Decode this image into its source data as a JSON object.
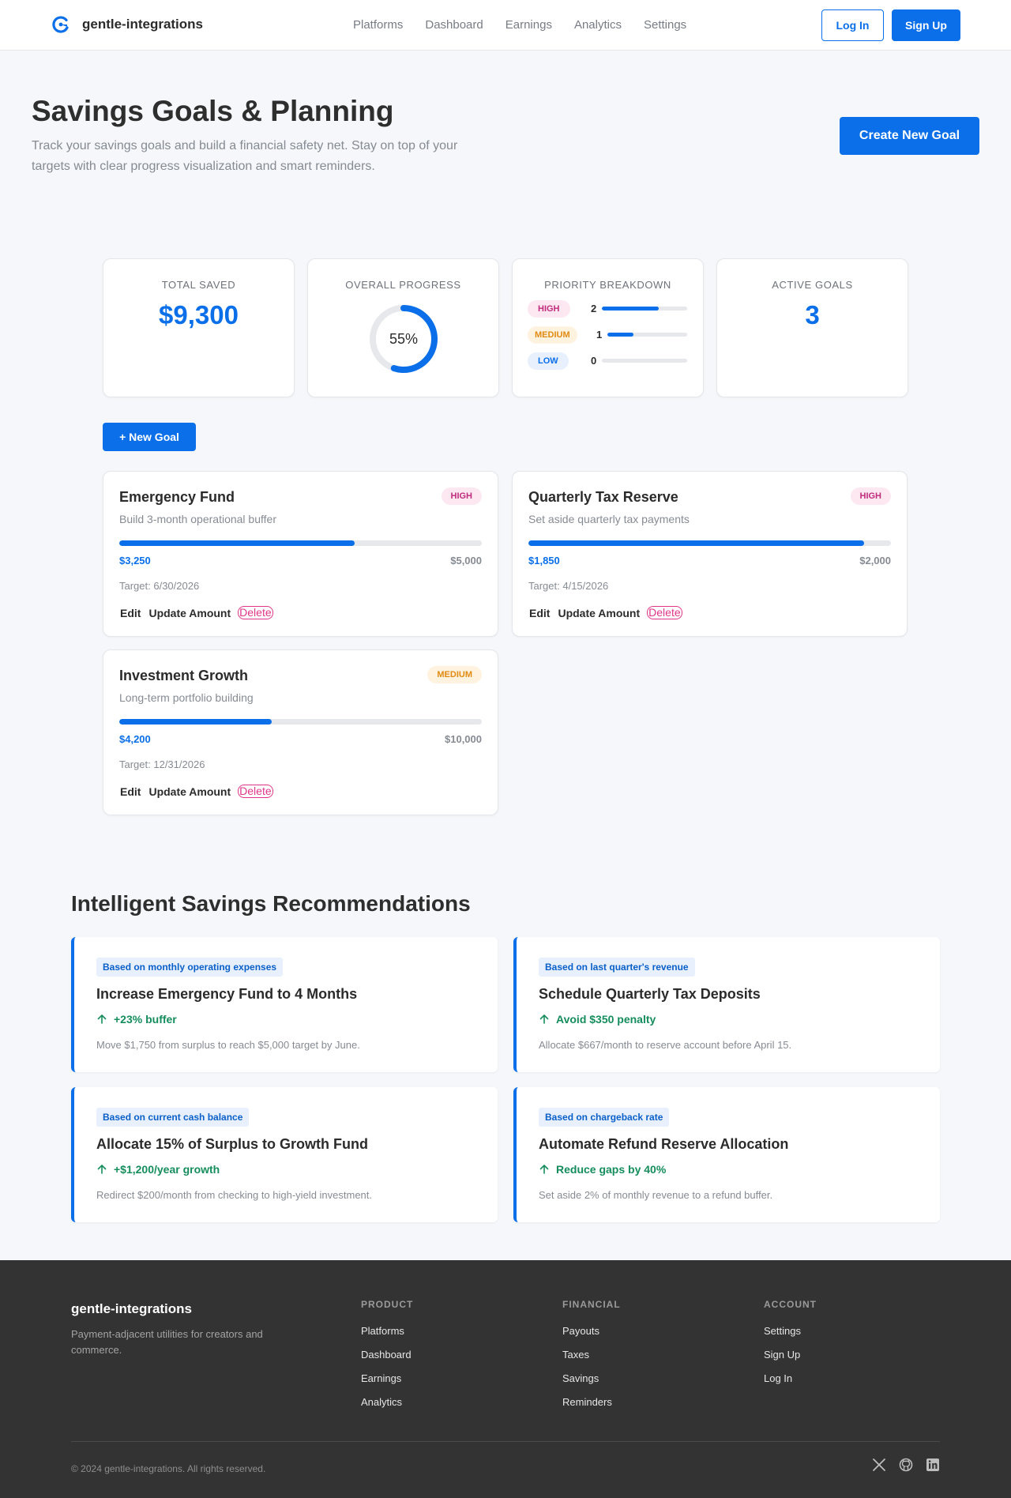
{
  "nav": {
    "brand": "gentle-integrations",
    "links": [
      "Platforms",
      "Dashboard",
      "Earnings",
      "Analytics",
      "Settings"
    ],
    "login": "Log In",
    "signup": "Sign Up"
  },
  "hero": {
    "title": "Savings Goals & Planning",
    "subtitle": "Track your savings goals and build a financial safety net. Stay on top of your targets with clear progress visualization and smart reminders.",
    "create_button": "Create New Goal"
  },
  "stats": {
    "total_saved": {
      "label": "TOTAL SAVED",
      "value": "$9,300"
    },
    "overall_progress": {
      "label": "OVERALL PROGRESS",
      "value": "55%",
      "fraction": 0.55
    },
    "priority": {
      "label": "PRIORITY BREAKDOWN",
      "rows": [
        {
          "name": "HIGH",
          "count": "2",
          "fill": 0.67
        },
        {
          "name": "MEDIUM",
          "count": "1",
          "fill": 0.33
        },
        {
          "name": "LOW",
          "count": "0",
          "fill": 0
        }
      ]
    },
    "active_goals": {
      "label": "ACTIVE GOALS",
      "value": "3"
    }
  },
  "new_goal_button": "+ New Goal",
  "goals": [
    {
      "title": "Emergency Fund",
      "priority": "HIGH",
      "desc": "Build 3-month operational buffer",
      "current": "$3,250",
      "target": "$5,000",
      "progress": 0.65,
      "date": "Target: 6/30/2026"
    },
    {
      "title": "Quarterly Tax Reserve",
      "priority": "HIGH",
      "desc": "Set aside quarterly tax payments",
      "current": "$1,850",
      "target": "$2,000",
      "progress": 0.925,
      "date": "Target: 4/15/2026"
    },
    {
      "title": "Investment Growth",
      "priority": "MEDIUM",
      "desc": "Long-term portfolio building",
      "current": "$4,200",
      "target": "$10,000",
      "progress": 0.42,
      "date": "Target: 12/31/2026"
    }
  ],
  "goal_actions": {
    "edit": "Edit",
    "update": "Update Amount",
    "delete": "Delete"
  },
  "recommendations": {
    "title": "Intelligent Savings Recommendations",
    "items": [
      {
        "tag": "Based on monthly operating expenses",
        "title": "Increase Emergency Fund to 4 Months",
        "impact": "+23% buffer",
        "detail": "Move $1,750 from surplus to reach $5,000 target by June."
      },
      {
        "tag": "Based on last quarter's revenue",
        "title": "Schedule Quarterly Tax Deposits",
        "impact": "Avoid $350 penalty",
        "detail": "Allocate $667/month to reserve account before April 15."
      },
      {
        "tag": "Based on current cash balance",
        "title": "Allocate 15% of Surplus to Growth Fund",
        "impact": "+$1,200/year growth",
        "detail": "Redirect $200/month from checking to high-yield investment."
      },
      {
        "tag": "Based on chargeback rate",
        "title": "Automate Refund Reserve Allocation",
        "impact": "Reduce gaps by 40%",
        "detail": "Set aside 2% of monthly revenue to a refund buffer."
      }
    ]
  },
  "footer": {
    "brand": "gentle-integrations",
    "tagline": "Payment-adjacent utilities for creators and commerce.",
    "columns": [
      {
        "title": "PRODUCT",
        "links": [
          "Platforms",
          "Dashboard",
          "Earnings",
          "Analytics"
        ]
      },
      {
        "title": "FINANCIAL",
        "links": [
          "Payouts",
          "Taxes",
          "Savings",
          "Reminders"
        ]
      },
      {
        "title": "ACCOUNT",
        "links": [
          "Settings",
          "Sign Up",
          "Log In"
        ]
      }
    ],
    "copyright": "© 2024 gentle-integrations. All rights reserved."
  },
  "colors": {
    "primary": "#0a6fe8",
    "high": "#c02b7c",
    "medium": "#e08a12",
    "low": "#0a6fe8",
    "positive": "#158d5c",
    "footer_bg": "#333333"
  },
  "icons": [
    "brand-logo-icon",
    "arrow-up-icon",
    "x-twitter-icon",
    "github-icon",
    "linkedin-icon"
  ]
}
